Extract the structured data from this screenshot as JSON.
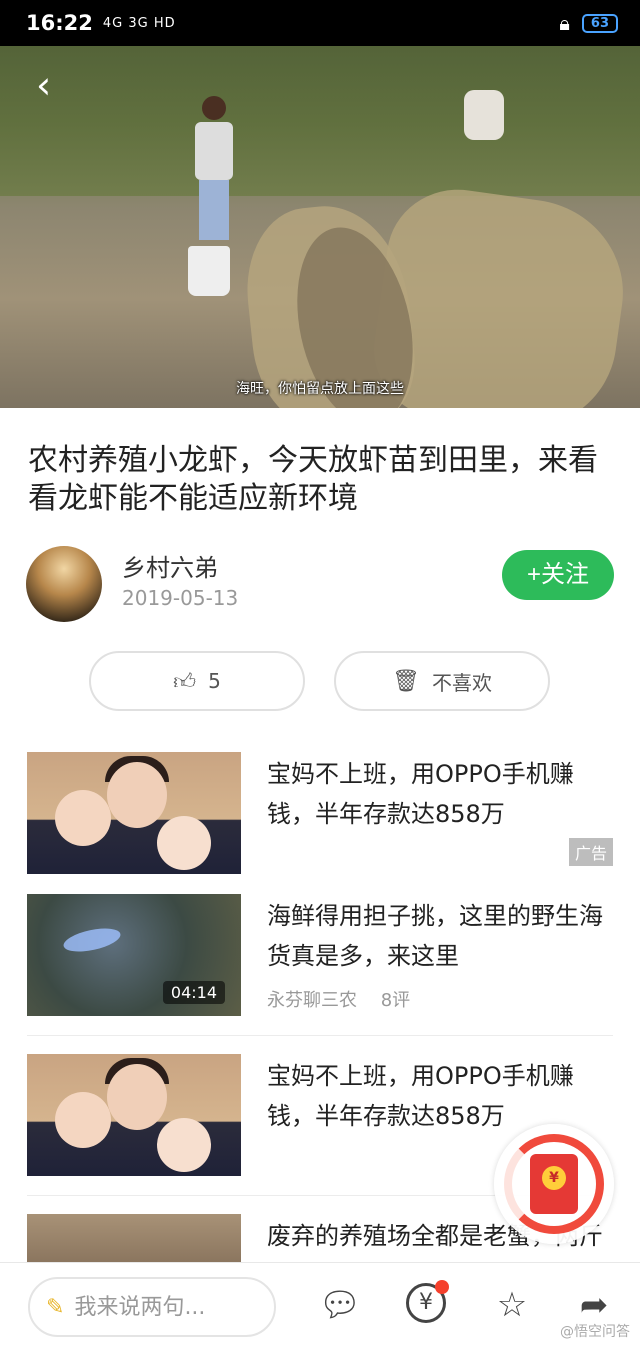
{
  "status": {
    "time": "16:22",
    "signal": "4G 3G HD",
    "battery": "63"
  },
  "video": {
    "caption": "海旺，你怕留点放上面这些",
    "back_glyph": "‹"
  },
  "article": {
    "title": "农村养殖小龙虾，今天放虾苗到田里，来看看龙虾能不能适应新环境",
    "author": "乡村六弟",
    "date": "2019-05-13",
    "follow_label": "+关注",
    "like_count": "5",
    "dislike_label": "不喜欢"
  },
  "feed": [
    {
      "title": "宝妈不上班，用OPPO手机赚钱，半年存款达858万",
      "badge": "广告",
      "thumb": "baby"
    },
    {
      "title": "海鲜得用担子挑，这里的野生海货真是多，来这里",
      "source": "永芬聊三农",
      "comments": "8评",
      "duration": "04:14",
      "thumb": "sea"
    },
    {
      "title": "宝妈不上班，用OPPO手机赚钱，半年存款达858万",
      "thumb": "baby"
    },
    {
      "title": "废弃的养殖场全都是老蟹，两斤一只算小的，阿",
      "thumb": "farm"
    }
  ],
  "redpacket": {
    "coin_glyph": "¥"
  },
  "bottom": {
    "comment_placeholder": "我来说两句...",
    "icons": [
      "comment-icon",
      "coin-icon",
      "star-icon",
      "share-icon"
    ],
    "watermark": "@悟空问答"
  },
  "colors": {
    "accent": "#2dbb5a",
    "red": "#f5402c"
  }
}
